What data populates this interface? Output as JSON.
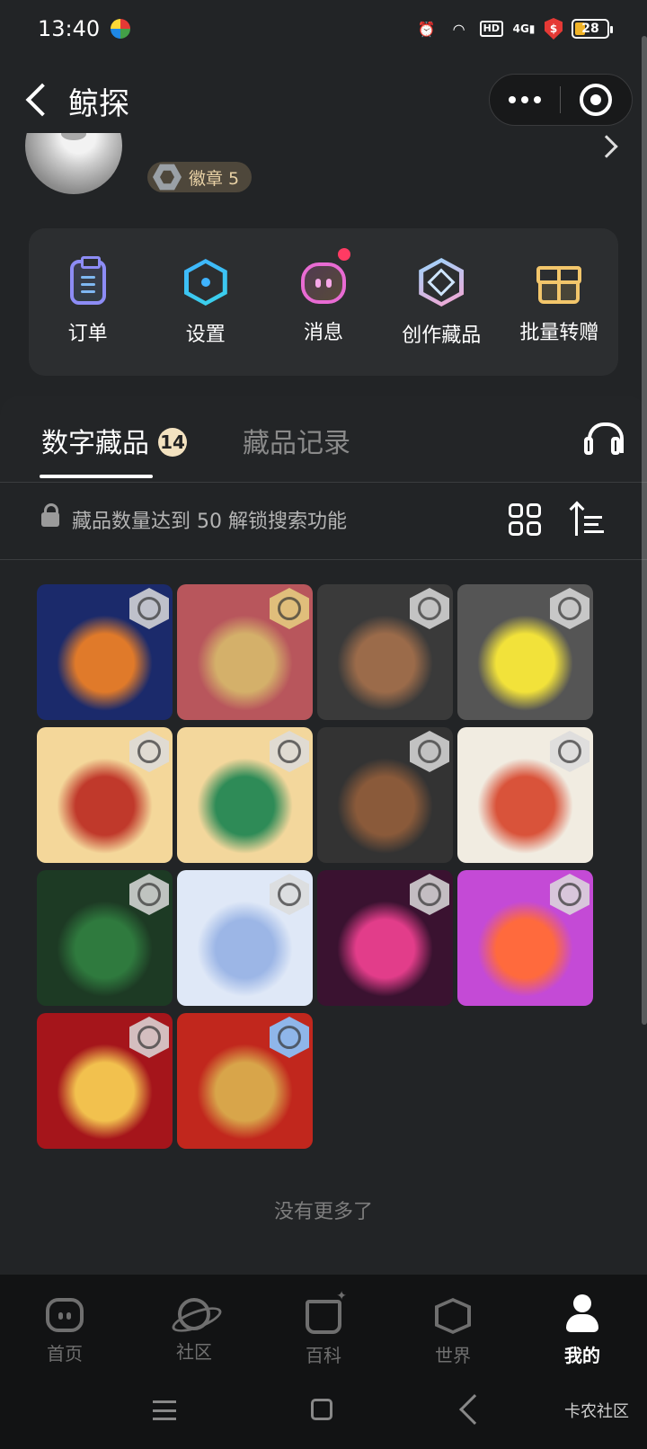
{
  "status_bar": {
    "time": "13:40",
    "network": "4G",
    "hd": "HD",
    "battery": "28",
    "icons": [
      "alarm-icon",
      "wifi-icon",
      "signal-icon",
      "shield-icon",
      "battery-icon"
    ]
  },
  "nav": {
    "title": "鲸探"
  },
  "profile": {
    "badge_label": "徽章 5"
  },
  "quick_actions": [
    {
      "label": "订单",
      "icon": "clipboard-icon"
    },
    {
      "label": "设置",
      "icon": "settings-hexagon-icon"
    },
    {
      "label": "消息",
      "icon": "message-face-icon",
      "unread": true
    },
    {
      "label": "创作藏品",
      "icon": "create-hexagon-icon"
    },
    {
      "label": "批量转赠",
      "icon": "gift-icon"
    }
  ],
  "tabs": {
    "active": {
      "label": "数字藏品",
      "count": "14"
    },
    "inactive": {
      "label": "藏品记录"
    }
  },
  "collection": {
    "unlock_hint": "藏品数量达到 50 解锁搜索功能",
    "items": [
      {
        "name": "collectible-basketball-badge",
        "bg": "#1b2a6b",
        "accent": "#e07a2a",
        "chain": "grey"
      },
      {
        "name": "collectible-tianguan-cifu",
        "bg": "#b8565c",
        "accent": "#d4b06a",
        "chain": "gold"
      },
      {
        "name": "collectible-wood-beads",
        "bg": "#3a3a3a",
        "accent": "#9b6b4a",
        "chain": "grey"
      },
      {
        "name": "collectible-zheba-logo",
        "bg": "#555555",
        "accent": "#f2e23a",
        "chain": "grey"
      },
      {
        "name": "collectible-caishen-group",
        "bg": "#f4d79a",
        "accent": "#c0392b",
        "chain": "grey"
      },
      {
        "name": "collectible-caishen-single",
        "bg": "#f3d79c",
        "accent": "#2e8b57",
        "chain": "grey"
      },
      {
        "name": "collectible-walnut",
        "bg": "#333333",
        "accent": "#8a5a3a",
        "chain": "grey"
      },
      {
        "name": "collectible-koi-fish",
        "bg": "#f1ece1",
        "accent": "#d9533a",
        "chain": "grey"
      },
      {
        "name": "collectible-snooker-table",
        "bg": "#1d3a24",
        "accent": "#2f7a3e",
        "chain": "grey"
      },
      {
        "name": "collectible-white-tiger",
        "bg": "#dfe8f7",
        "accent": "#9cb6e6",
        "chain": "grey"
      },
      {
        "name": "collectible-racing-helmet",
        "bg": "#3a1230",
        "accent": "#e23d8a",
        "chain": "grey"
      },
      {
        "name": "collectible-red-bird",
        "bg": "#c44ad6",
        "accent": "#ff6a3d",
        "chain": "grey"
      },
      {
        "name": "collectible-caishen-red",
        "bg": "#a5151b",
        "accent": "#f2c14e",
        "chain": "grey"
      },
      {
        "name": "collectible-fu-character",
        "bg": "#c1271d",
        "accent": "#d8a54a",
        "chain": "blue"
      }
    ],
    "end_text": "没有更多了"
  },
  "bottom_nav": [
    {
      "label": "首页",
      "icon": "home-face-icon",
      "active": false
    },
    {
      "label": "社区",
      "icon": "planet-icon",
      "active": false
    },
    {
      "label": "百科",
      "icon": "encyclopedia-icon",
      "active": false
    },
    {
      "label": "世界",
      "icon": "box-icon",
      "active": false
    },
    {
      "label": "我的",
      "icon": "user-icon",
      "active": true
    }
  ],
  "watermark": "卡农社区"
}
